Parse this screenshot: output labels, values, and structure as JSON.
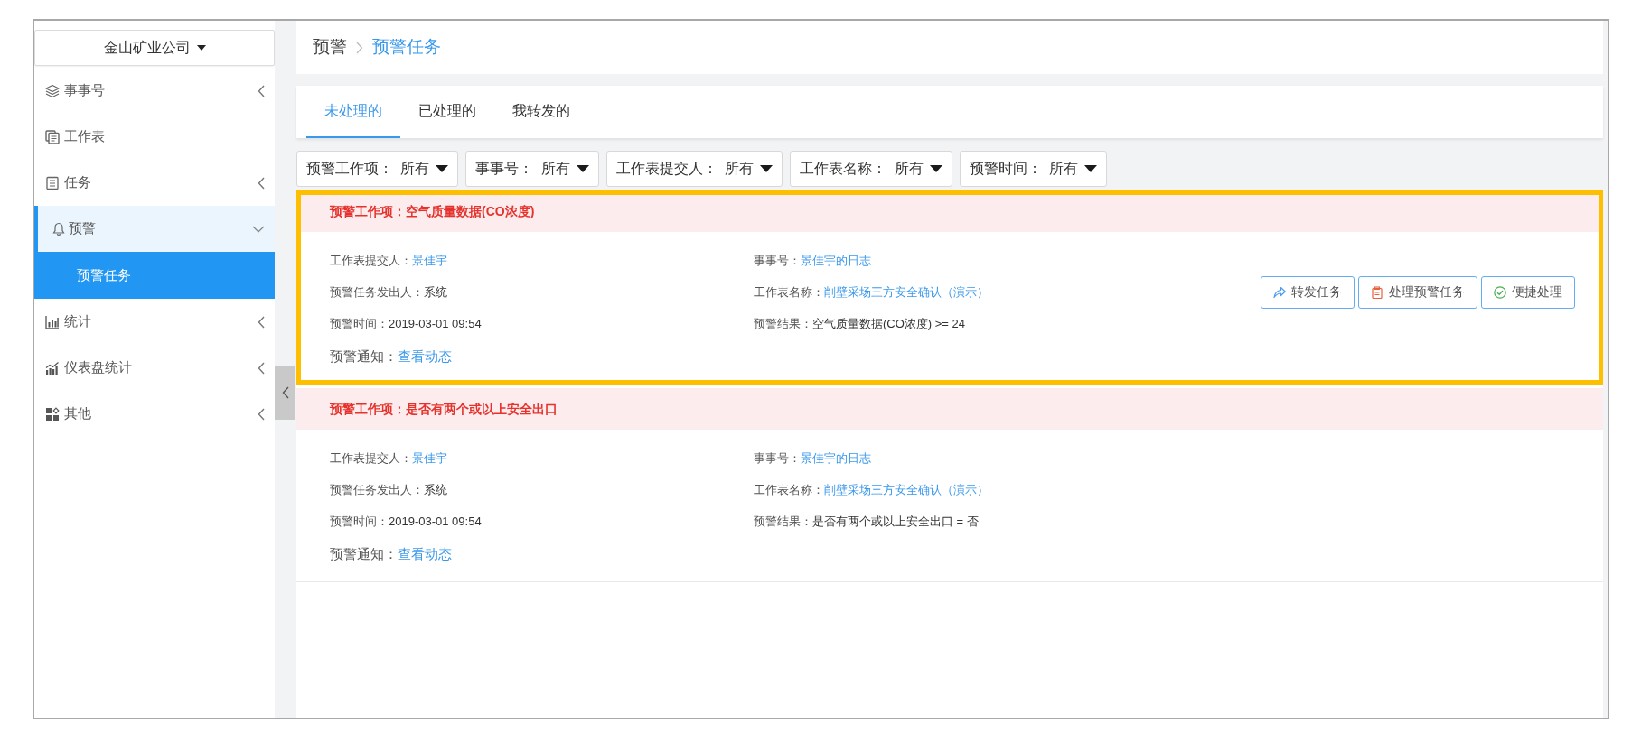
{
  "sidebar": {
    "company": "金山矿业公司",
    "items": [
      {
        "label": "事事号",
        "kind": "group",
        "expanded": false,
        "selected": false
      },
      {
        "label": "工作表",
        "kind": "link",
        "selected": false
      },
      {
        "label": "任务",
        "kind": "group",
        "expanded": false,
        "selected": false
      },
      {
        "label": "预警",
        "kind": "group",
        "expanded": true,
        "selected": false,
        "children": [
          {
            "label": "预警任务",
            "selected": true
          }
        ]
      },
      {
        "label": "统计",
        "kind": "group",
        "expanded": false,
        "selected": false
      },
      {
        "label": "仪表盘统计",
        "kind": "group",
        "expanded": false,
        "selected": false
      },
      {
        "label": "其他",
        "kind": "group",
        "expanded": false,
        "selected": false
      }
    ]
  },
  "breadcrumb": [
    "预警",
    "预警任务"
  ],
  "tabs": [
    {
      "label": "未处理的",
      "selected": true
    },
    {
      "label": "已处理的",
      "selected": false
    },
    {
      "label": "我转发的",
      "selected": false
    }
  ],
  "filters": [
    {
      "label": "预警工作项：",
      "value": "所有"
    },
    {
      "label": "事事号：",
      "value": "所有"
    },
    {
      "label": "工作表提交人：",
      "value": "所有"
    },
    {
      "label": "工作表名称：",
      "value": "所有"
    },
    {
      "label": "预警时间：",
      "value": "所有"
    }
  ],
  "alerts": [
    {
      "title": "预警工作项：空气质量数据(CO浓度)",
      "highlighted": true,
      "details": [
        {
          "label": "工作表提交人：",
          "value": "景佳宇",
          "link": true
        },
        {
          "label": "事事号：",
          "value": "景佳宇的日志",
          "link": true
        },
        {
          "label": "预警任务发出人：",
          "value": "系统",
          "link": false
        },
        {
          "label": "工作表名称：",
          "value": "削壁采场三方安全确认（演示）",
          "link": true
        },
        {
          "label": "预警时间：",
          "value": "2019-03-01 09:54",
          "link": false
        },
        {
          "label": "预警结果：",
          "value": "空气质量数据(CO浓度) >= 24",
          "link": false
        }
      ],
      "notice": {
        "label": "预警通知：",
        "link": "查看动态"
      },
      "actions": [
        "转发任务",
        "处理预警任务",
        "便捷处理"
      ]
    },
    {
      "title": "预警工作项：是否有两个或以上安全出口",
      "highlighted": false,
      "details": [
        {
          "label": "工作表提交人：",
          "value": "景佳宇",
          "link": true
        },
        {
          "label": "事事号：",
          "value": "景佳宇的日志",
          "link": true
        },
        {
          "label": "预警任务发出人：",
          "value": "系统",
          "link": false
        },
        {
          "label": "工作表名称：",
          "value": "削壁采场三方安全确认（演示）",
          "link": true
        },
        {
          "label": "预警时间：",
          "value": "2019-03-01 09:54",
          "link": false
        },
        {
          "label": "预警结果：",
          "value": "是否有两个或以上安全出口 = 否",
          "link": false
        }
      ],
      "notice": {
        "label": "预警通知：",
        "link": "查看动态"
      }
    }
  ]
}
